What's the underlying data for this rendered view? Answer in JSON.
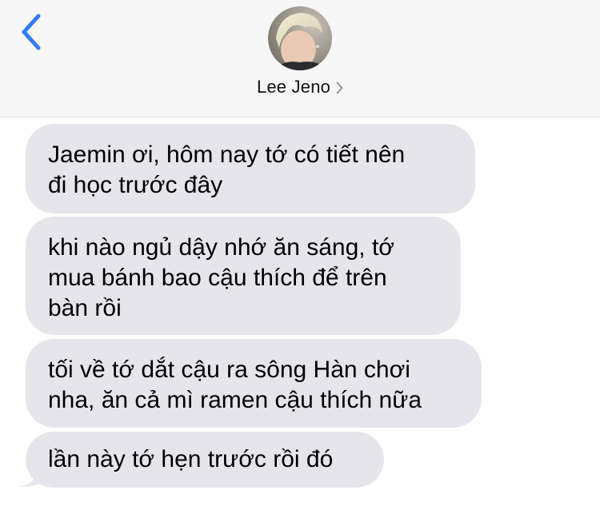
{
  "header": {
    "contact_name": "Lee Jeno",
    "avatar": "contact-avatar",
    "back_icon": "chevron-left-icon",
    "details_icon": "chevron-right-icon",
    "accent_color": "#2f7cf6"
  },
  "messages": [
    {
      "text": "Jaemin ơi, hôm nay tớ có tiết nên\nđi học trước đây",
      "direction": "incoming"
    },
    {
      "text": "khi nào ngủ dậy nhớ ăn sáng, tớ\nmua bánh bao cậu thích để trên\nbàn rồi",
      "direction": "incoming"
    },
    {
      "text": "tối về tớ dắt cậu ra sông Hàn chơi\nnha, ăn cả mì ramen cậu thích nữa",
      "direction": "incoming"
    },
    {
      "text": "lần này tớ hẹn trước rồi đó",
      "direction": "incoming"
    }
  ],
  "colors": {
    "header_bg": "#f7f7f7",
    "incoming_bubble": "#e6e5eb",
    "text": "#000000"
  }
}
